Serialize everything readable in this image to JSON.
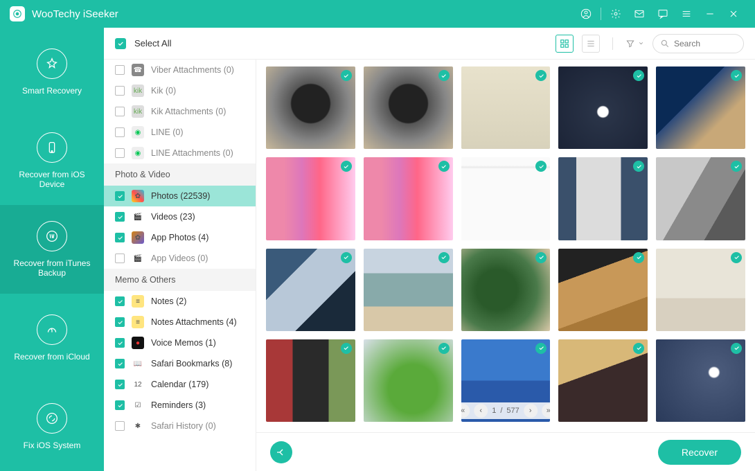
{
  "app_title": "WooTechy iSeeker",
  "toolbar": {
    "select_all": "Select All",
    "search_placeholder": "Search"
  },
  "nav": [
    {
      "label": "Smart Recovery"
    },
    {
      "label": "Recover from iOS Device"
    },
    {
      "label": "Recover from iTunes Backup"
    },
    {
      "label": "Recover from iCloud"
    },
    {
      "label": "Fix iOS System"
    }
  ],
  "nav_active": 2,
  "categories": [
    {
      "type": "item",
      "label": "Viber Attachments (0)",
      "checked": false,
      "icon": "viber",
      "iconBg": "#888",
      "iconFg": "#fff"
    },
    {
      "type": "item",
      "label": "Kik (0)",
      "checked": false,
      "icon": "kik",
      "iconBg": "#ddd",
      "iconFg": "#6a5"
    },
    {
      "type": "item",
      "label": "Kik Attachments (0)",
      "checked": false,
      "icon": "kik",
      "iconBg": "#ddd",
      "iconFg": "#6a5"
    },
    {
      "type": "item",
      "label": "LINE (0)",
      "checked": false,
      "icon": "line",
      "iconBg": "#eee",
      "iconFg": "#06C755"
    },
    {
      "type": "item",
      "label": "LINE Attachments (0)",
      "checked": false,
      "icon": "line",
      "iconBg": "#eee",
      "iconFg": "#06C755"
    },
    {
      "type": "group",
      "label": "Photo & Video"
    },
    {
      "type": "item",
      "label": "Photos (22539)",
      "checked": true,
      "selected": true,
      "icon": "photos",
      "iconBg": "linear-gradient(45deg,#f9d423,#ff4e50,#24c6dc)",
      "bold": true
    },
    {
      "type": "item",
      "label": "Videos (23)",
      "checked": true,
      "icon": "videos",
      "iconBg": "#fff",
      "bold": true
    },
    {
      "type": "item",
      "label": "App Photos (4)",
      "checked": true,
      "icon": "appphotos",
      "iconBg": "linear-gradient(135deg,#d38312,#6a5acd)",
      "bold": true
    },
    {
      "type": "item",
      "label": "App Videos (0)",
      "checked": false,
      "icon": "appvideos",
      "iconBg": "#fff"
    },
    {
      "type": "group",
      "label": "Memo & Others"
    },
    {
      "type": "item",
      "label": "Notes (2)",
      "checked": true,
      "icon": "notes",
      "iconBg": "#ffe57f",
      "bold": true
    },
    {
      "type": "item",
      "label": "Notes Attachments (4)",
      "checked": true,
      "icon": "notes",
      "iconBg": "#ffe57f",
      "bold": true
    },
    {
      "type": "item",
      "label": "Voice Memos (1)",
      "checked": true,
      "icon": "voice",
      "iconBg": "#111",
      "iconFg": "#e33",
      "bold": true
    },
    {
      "type": "item",
      "label": "Safari Bookmarks (8)",
      "checked": true,
      "icon": "bookmark",
      "iconBg": "#fff",
      "bold": true
    },
    {
      "type": "item",
      "label": "Calendar (179)",
      "checked": true,
      "icon": "calendar",
      "iconBg": "#fff",
      "bold": true
    },
    {
      "type": "item",
      "label": "Reminders (3)",
      "checked": true,
      "icon": "reminders",
      "iconBg": "#fff",
      "bold": true
    },
    {
      "type": "item",
      "label": "Safari History (0)",
      "checked": false,
      "icon": "safari",
      "iconBg": "#fff"
    }
  ],
  "pager": {
    "current": "1",
    "sep": "/",
    "total": "577"
  },
  "recover_label": "Recover",
  "thumbs": [
    {
      "bg": "radial-gradient(circle at 50% 45%, #222 30%, #555 32%, #888 60%, #c8b89a 100%)"
    },
    {
      "bg": "radial-gradient(circle at 50% 45%, #222 30%, #555 32%, #888 60%, #c8b89a 100%)"
    },
    {
      "bg": "linear-gradient(180deg,#e8e2cc,#d8d2bb)"
    },
    {
      "bg": "radial-gradient(circle at 50% 55%,#fff 8%,#2a3448 10%,#1a2235 100%)"
    },
    {
      "bg": "linear-gradient(135deg,#0a2a55 40%,#2c4a7a 40%,#c8a878 70%)"
    },
    {
      "bg": "linear-gradient(90deg,#e8a 20%,#d7b 40%,#f68 60%,#fce 100%)"
    },
    {
      "bg": "linear-gradient(90deg,#e8a 20%,#d7b 40%,#f68 60%,#fce 100%)"
    },
    {
      "bg": "linear-gradient(180deg,#fafafa 10%,#e9e9e9 12%,#fafafa 14%)"
    },
    {
      "bg": "linear-gradient(90deg,#3a506b 20%,#dcdcdc 20% 70%,#3a506b 70%)"
    },
    {
      "bg": "linear-gradient(120deg,#c8c8c8 40%,#8a8a8a 40% 70%,#5a5a5a 70%)"
    },
    {
      "bg": "linear-gradient(135deg,#3a5a7a 30%,#b8c8d8 30% 65%,#1a2a3a 65%)"
    },
    {
      "bg": "linear-gradient(180deg,#c8d4e0 30%,#8aa 30% 70%,#d8c8a8 70%)"
    },
    {
      "bg": "radial-gradient(circle at 40% 50%,#2a5a2a 30%,#4a7a4a 60%,#d8c8a8 100%)"
    },
    {
      "bg": "linear-gradient(160deg,#222 30%,#c89858 30% 70%,#a87838 70%)"
    },
    {
      "bg": "linear-gradient(180deg,#e8e4d8 60%,#d8d0c0 60%)"
    },
    {
      "bg": "linear-gradient(90deg,#a83838 30%,#2a2a2a 30% 70%,#7a9858 70%)"
    },
    {
      "bg": "radial-gradient(circle at 55% 60%,#5aaa3a 35%,#d8e0e8 100%)"
    },
    {
      "bg": "linear-gradient(180deg,#3a7acc 50%,#2a5aaa 50%)"
    },
    {
      "bg": "linear-gradient(160deg,#d8b878 40%,#3a2a2a 40%)"
    },
    {
      "bg": "radial-gradient(circle at 65% 40%,#fff 6%,#4a5a7a 8%,#2a3a5a 100%)"
    }
  ]
}
